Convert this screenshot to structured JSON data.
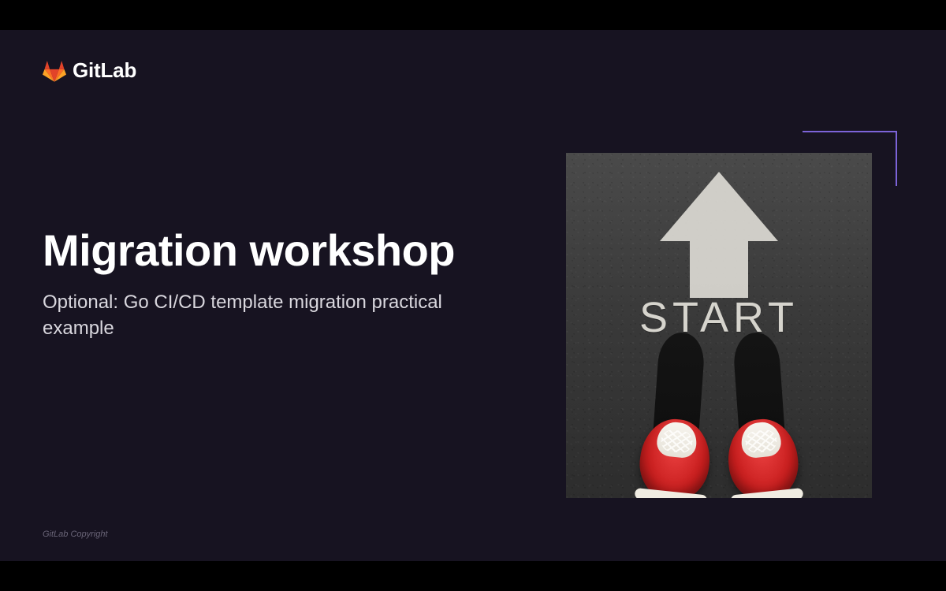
{
  "brand": {
    "name": "GitLab"
  },
  "slide": {
    "title": "Migration workshop",
    "subtitle": "Optional: Go CI/CD template migration practical example",
    "copyright": "GitLab Copyright"
  },
  "illustration": {
    "paint_text": "START",
    "icon": "arrow-up-icon",
    "description": "Top-down view of a person in red sneakers standing on asphalt with a painted white arrow and the word START"
  },
  "colors": {
    "background": "#171321",
    "accent": "#7c63d8"
  }
}
